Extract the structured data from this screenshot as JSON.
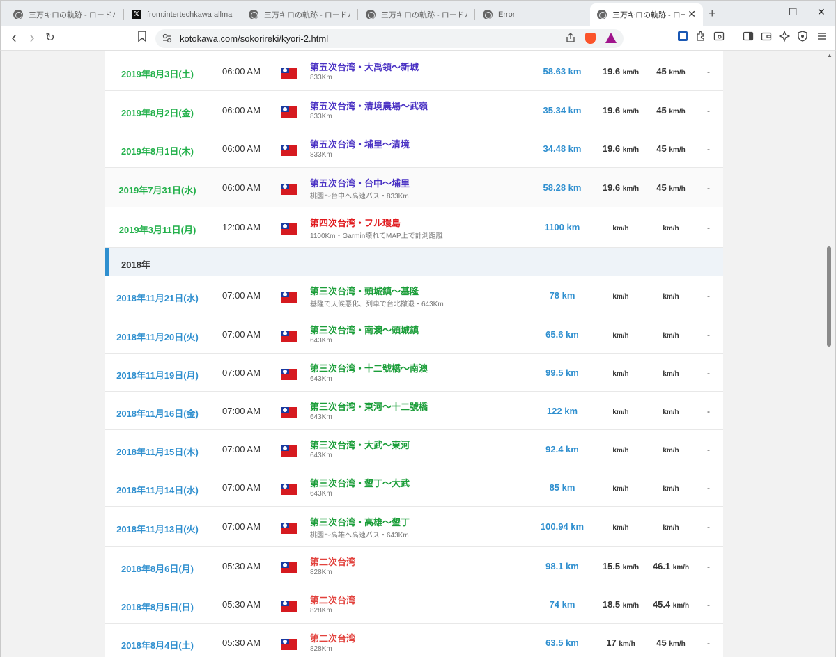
{
  "browser": {
    "tabs": [
      {
        "label": "三万キロの軌跡 - ロードバイク",
        "icon": "globe-icon",
        "active": false
      },
      {
        "label": "from:intertechkawa allman",
        "icon": "x-logo-icon",
        "active": false
      },
      {
        "label": "三万キロの軌跡 - ロードバイク",
        "icon": "globe-icon",
        "active": false
      },
      {
        "label": "三万キロの軌跡 - ロードバイク",
        "icon": "globe-icon",
        "active": false
      },
      {
        "label": "Error",
        "icon": "globe-icon",
        "active": false
      },
      {
        "label": "三万キロの軌跡 - ロード",
        "icon": "globe-icon",
        "active": true
      }
    ],
    "tab_close_glyph": "✕",
    "new_tab_glyph": "+",
    "window_controls": {
      "minimize": "—",
      "maximize": "☐",
      "close": "✕"
    },
    "url": "kotokawa.com/sokorireki/kyori-2.html",
    "nav": {
      "back": "‹",
      "forward": "›",
      "reload": "↻"
    }
  },
  "units": {
    "speed": "km/h"
  },
  "rows_2019": [
    {
      "date": "2019年8月3日(土)",
      "time": "06:00 AM",
      "title": "第五次台湾・大禹領〜新城",
      "sub": "833Km",
      "dist": "58.63 km",
      "avg": "19.6",
      "max": "45",
      "note": "-",
      "title_color": "purple",
      "alt": false
    },
    {
      "date": "2019年8月2日(金)",
      "time": "06:00 AM",
      "title": "第五次台湾・清境農場〜武嶺",
      "sub": "833Km",
      "dist": "35.34 km",
      "avg": "19.6",
      "max": "45",
      "note": "-",
      "title_color": "purple",
      "alt": false
    },
    {
      "date": "2019年8月1日(木)",
      "time": "06:00 AM",
      "title": "第五次台湾・埔里〜清境",
      "sub": "833Km",
      "dist": "34.48 km",
      "avg": "19.6",
      "max": "45",
      "note": "-",
      "title_color": "purple",
      "alt": false
    },
    {
      "date": "2019年7月31日(水)",
      "time": "06:00 AM",
      "title": "第五次台湾・台中〜埔里",
      "sub": "桃園〜台中へ高速バス・833Km",
      "dist": "58.28 km",
      "avg": "19.6",
      "max": "45",
      "note": "-",
      "title_color": "purple",
      "alt": true
    },
    {
      "date": "2019年3月11日(月)",
      "time": "12:00 AM",
      "title": "第四次台湾・フル環島",
      "sub": "1100Km・Garmin壊れてMAP上で計測距離",
      "dist": "1100 km",
      "avg": "",
      "max": "",
      "note": "-",
      "title_color": "red",
      "alt": false
    }
  ],
  "year_header": "2018年",
  "rows_2018": [
    {
      "date": "2018年11月21日(水)",
      "time": "07:00 AM",
      "title": "第三次台湾・頭城鎮〜基隆",
      "sub": "基隆で天候悪化、列車で台北撤退・643Km",
      "dist": "78 km",
      "avg": "",
      "max": "",
      "note": "-",
      "title_color": "green"
    },
    {
      "date": "2018年11月20日(火)",
      "time": "07:00 AM",
      "title": "第三次台湾・南澳〜頭城鎮",
      "sub": "643Km",
      "dist": "65.6 km",
      "avg": "",
      "max": "",
      "note": "-",
      "title_color": "green"
    },
    {
      "date": "2018年11月19日(月)",
      "time": "07:00 AM",
      "title": "第三次台湾・十二號橋〜南澳",
      "sub": "643Km",
      "dist": "99.5 km",
      "avg": "",
      "max": "",
      "note": "-",
      "title_color": "green"
    },
    {
      "date": "2018年11月16日(金)",
      "time": "07:00 AM",
      "title": "第三次台湾・東河〜十二號橋",
      "sub": "643Km",
      "dist": "122 km",
      "avg": "",
      "max": "",
      "note": "-",
      "title_color": "green"
    },
    {
      "date": "2018年11月15日(木)",
      "time": "07:00 AM",
      "title": "第三次台湾・大武〜東河",
      "sub": "643Km",
      "dist": "92.4 km",
      "avg": "",
      "max": "",
      "note": "-",
      "title_color": "green"
    },
    {
      "date": "2018年11月14日(水)",
      "time": "07:00 AM",
      "title": "第三次台湾・墾丁〜大武",
      "sub": "643Km",
      "dist": "85 km",
      "avg": "",
      "max": "",
      "note": "-",
      "title_color": "green"
    },
    {
      "date": "2018年11月13日(火)",
      "time": "07:00 AM",
      "title": "第三次台湾・高雄〜墾丁",
      "sub": "桃園〜高雄へ高速バス・643Km",
      "dist": "100.94 km",
      "avg": "",
      "max": "",
      "note": "-",
      "title_color": "green"
    },
    {
      "date": "2018年8月6日(月)",
      "time": "05:30 AM",
      "title": "第二次台湾",
      "sub": "828Km",
      "dist": "98.1 km",
      "avg": "15.5",
      "max": "46.1",
      "note": "-",
      "title_color": "salmon"
    },
    {
      "date": "2018年8月5日(日)",
      "time": "05:30 AM",
      "title": "第二次台湾",
      "sub": "828Km",
      "dist": "74 km",
      "avg": "18.5",
      "max": "45.4",
      "note": "-",
      "title_color": "salmon"
    },
    {
      "date": "2018年8月4日(土)",
      "time": "05:30 AM",
      "title": "第二次台湾",
      "sub": "828Km",
      "dist": "63.5 km",
      "avg": "17",
      "max": "45",
      "note": "-",
      "title_color": "salmon"
    }
  ]
}
